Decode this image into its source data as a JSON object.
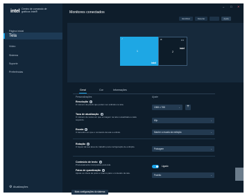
{
  "app": {
    "logo": "intel",
    "brand_name": "Centro de comando de gráficos Intel®",
    "title": "Monitores conectados"
  },
  "window_controls": {
    "minimize": "–",
    "maximize": "□",
    "close": "✕"
  },
  "sidebar": {
    "items": [
      {
        "label": "Página inicial"
      },
      {
        "label": "Tela"
      },
      {
        "label": "Vídeo"
      },
      {
        "label": "Sistema"
      },
      {
        "label": "Suporte"
      },
      {
        "label": "Preferências"
      }
    ],
    "settings_label": "Atualizações"
  },
  "header_buttons": {
    "identify": "Identificar",
    "detect": "Detectar",
    "blank": "",
    "help": "Ajuda"
  },
  "monitors": [
    {
      "number": "1",
      "brand": "intel",
      "badge": "✓",
      "selected": true
    },
    {
      "number": "2",
      "brand": "intel",
      "badge": "⊘",
      "selected": false,
      "menu": "•••"
    }
  ],
  "tabs": [
    {
      "label": "Geral"
    },
    {
      "label": "Cor"
    },
    {
      "label": "Informações"
    }
  ],
  "column_headers": {
    "left": "Personalizações",
    "right": "Ajuste"
  },
  "settings": {
    "resolution": {
      "label": "Resolução",
      "desc": "O número de pixels que podem ser exibidos na tela.",
      "value": "1366 x 768",
      "add": "+"
    },
    "refresh_rate": {
      "label": "Taxa de atualização",
      "desc": "O número de vezes em que a imagem na tela é atualizada a cada segundo.",
      "value": "60p"
    },
    "scale": {
      "label": "Escala",
      "desc": "O tamanho em que o conteúdo da tela é exibido.",
      "value": "Manter a escala da exibição"
    },
    "rotation": {
      "label": "Rotação",
      "desc": "O layout da sua área de trabalho para configuração de exibição.",
      "value": "Paisagem"
    },
    "content_color": {
      "label": "Conteúdo de texto",
      "desc": "Processamento incorporado para tela.",
      "toggle_label": "Ligado",
      "enabled": true
    },
    "quantization": {
      "label": "Faixa de quantização",
      "desc": "Ajuste os níveis de preto e branco para o conteúdo da tela.",
      "value": "Padrão"
    }
  },
  "restore_button": "Mais configurações do sistema",
  "colors": {
    "accent": "#1aa3e8",
    "background": "#0e1d2b",
    "sidebar": "#13273a"
  }
}
